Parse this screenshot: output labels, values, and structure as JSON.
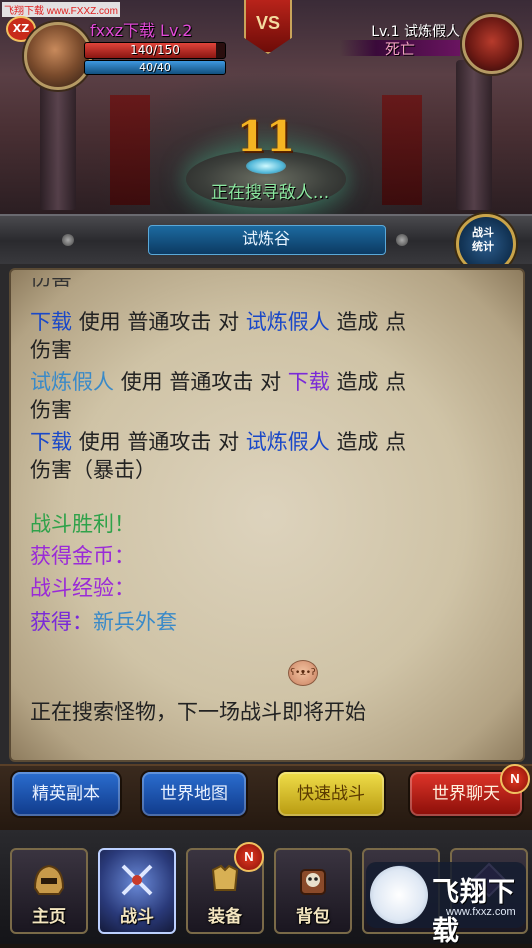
{
  "watermark": "飞翔下载 www.FXXZ.com",
  "top_badge": "XZ",
  "vs_label": "VS",
  "player": {
    "name": "fxxz下载 Lv.2",
    "hp_text": "140/150",
    "hp_fraction": 0.933,
    "mp_text": "40/40",
    "mp_fraction": 1.0
  },
  "enemy": {
    "name": "Lv.1 试炼假人",
    "status": "死亡"
  },
  "round_number": "11",
  "search_status": "正在搜寻敌人...",
  "location_title": "试炼谷",
  "stats_button": {
    "line1": "战斗",
    "line2": "统计"
  },
  "log": {
    "cut_line": "伤害",
    "entries": [
      {
        "actor": "下载",
        "use": "使用",
        "skill": "普通攻击",
        "to": "对",
        "target": "试炼假人",
        "deal": "造成",
        "point": "点",
        "tail": "伤害"
      },
      {
        "actor": "试炼假人",
        "use": "使用",
        "skill": "普通攻击",
        "to": "对",
        "target": "下载",
        "deal": "造成",
        "point": "点",
        "tail": "伤害"
      },
      {
        "actor": "下载",
        "use": "使用",
        "skill": "普通攻击",
        "to": "对",
        "target": "试炼假人",
        "deal": "造成",
        "point": "点",
        "tail": "伤害（暴击）"
      }
    ],
    "victory": "战斗胜利！",
    "gold": "获得金币：",
    "exp": "战斗经验：",
    "loot_label": "获得：",
    "loot_item": "新兵外套",
    "footer": "正在搜索怪物，下一场战斗即将开始"
  },
  "actions": {
    "elite": "精英副本",
    "world_map": "世界地图",
    "quick_battle": "快速战斗",
    "world_chat": "世界聊天",
    "chat_badge": "N"
  },
  "nav": {
    "home": "主页",
    "battle": "战斗",
    "equipment": "装备",
    "bag": "背包",
    "equip_badge": "N"
  },
  "logo": {
    "text": "飞翔下载",
    "url": "www.fxxz.com"
  },
  "colors": {
    "player_name": "#e34ad8",
    "round_number": "#f5b422",
    "victory": "#2fa24a",
    "log_blue": "#1a48c8",
    "log_purple": "#7a2ad8"
  }
}
